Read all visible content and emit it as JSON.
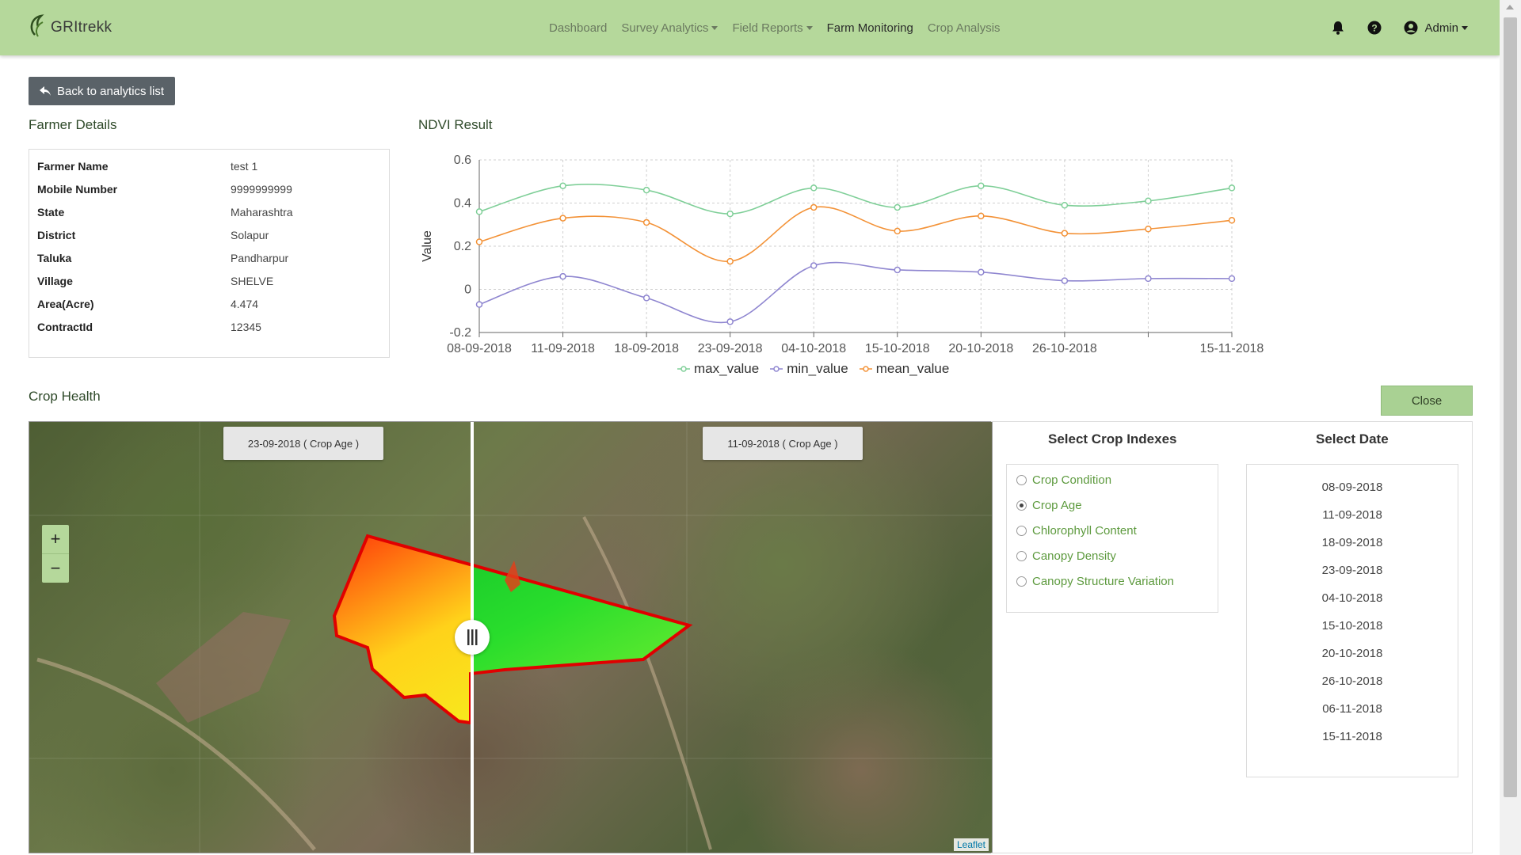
{
  "brand": {
    "logo_text": "GRItrekk"
  },
  "nav": {
    "items": [
      {
        "label": "Dashboard",
        "dropdown": false,
        "active": false
      },
      {
        "label": "Survey Analytics",
        "dropdown": true,
        "active": false
      },
      {
        "label": "Field Reports",
        "dropdown": true,
        "active": false
      },
      {
        "label": "Farm Monitoring",
        "dropdown": false,
        "active": true
      },
      {
        "label": "Crop Analysis",
        "dropdown": false,
        "active": false
      }
    ],
    "user": "Admin",
    "icons": [
      "bell-icon",
      "question-circle-icon",
      "user-circle-icon"
    ]
  },
  "back_button": "Back to analytics list",
  "farmer": {
    "title": "Farmer Details",
    "rows": [
      {
        "label": "Farmer Name",
        "value": "test 1"
      },
      {
        "label": "Mobile Number",
        "value": "9999999999"
      },
      {
        "label": "State",
        "value": "Maharashtra"
      },
      {
        "label": "District",
        "value": "Solapur"
      },
      {
        "label": "Taluka",
        "value": "Pandharpur"
      },
      {
        "label": "Village",
        "value": "SHELVE"
      },
      {
        "label": "Area(Acre)",
        "value": "4.474"
      },
      {
        "label": "ContractId",
        "value": "12345"
      }
    ]
  },
  "ndvi": {
    "title": "NDVI Result"
  },
  "chart_data": {
    "type": "line",
    "title": "",
    "xlabel": "",
    "ylabel": "Value",
    "ylim": [
      -0.2,
      0.6
    ],
    "yticks": [
      "-0.2",
      "0",
      "0.2",
      "0.4",
      "0.6"
    ],
    "x": [
      "08-09-2018",
      "11-09-2018",
      "18-09-2018",
      "23-09-2018",
      "04-10-2018",
      "15-10-2018",
      "20-10-2018",
      "26-10-2018",
      "06-11-2018",
      "15-11-2018"
    ],
    "xtick_labels": [
      "08-09-2018",
      "11-09-2018",
      "18-09-2018",
      "23-09-2018",
      "04-10-2018",
      "15-10-2018",
      "20-10-2018",
      "26-10-2018",
      "",
      "15-11-2018"
    ],
    "grid": true,
    "legend": "bottom",
    "series": [
      {
        "name": "max_value",
        "color": "#7fcf98",
        "values": [
          0.36,
          0.48,
          0.46,
          0.35,
          0.47,
          0.38,
          0.48,
          0.39,
          0.41,
          0.47
        ]
      },
      {
        "name": "min_value",
        "color": "#8f86d0",
        "values": [
          -0.07,
          0.06,
          -0.04,
          -0.15,
          0.11,
          0.09,
          0.08,
          0.04,
          0.05,
          0.05
        ]
      },
      {
        "name": "mean_value",
        "color": "#f39237",
        "values": [
          0.22,
          0.33,
          0.31,
          0.13,
          0.38,
          0.27,
          0.34,
          0.26,
          0.28,
          0.32
        ]
      }
    ]
  },
  "crop_health": {
    "title": "Crop Health",
    "close_label": "Close",
    "left_tag": "23-09-2018 ( Crop Age )",
    "right_tag": "11-09-2018 ( Crop Age )",
    "attribution": "Leaflet"
  },
  "indexes": {
    "title": "Select Crop Indexes",
    "options": [
      {
        "label": "Crop Condition",
        "checked": false
      },
      {
        "label": "Crop Age",
        "checked": true
      },
      {
        "label": "Chlorophyll Content",
        "checked": false
      },
      {
        "label": "Canopy Density",
        "checked": false
      },
      {
        "label": "Canopy Structure Variation",
        "checked": false
      }
    ]
  },
  "dates": {
    "title": "Select Date",
    "items": [
      "08-09-2018",
      "11-09-2018",
      "18-09-2018",
      "23-09-2018",
      "04-10-2018",
      "15-10-2018",
      "20-10-2018",
      "26-10-2018",
      "06-11-2018",
      "15-11-2018"
    ]
  }
}
